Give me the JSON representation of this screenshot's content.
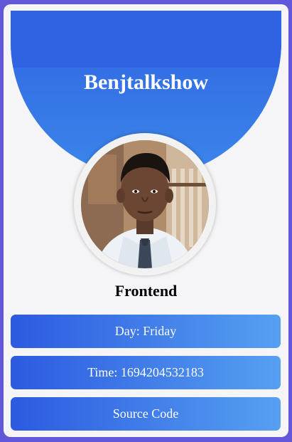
{
  "profile": {
    "name": "Benjtalkshow",
    "role": "Frontend"
  },
  "info": {
    "day_label": "Day: Friday",
    "time_label": "Time: 1694204532183"
  },
  "actions": {
    "source_code_label": "Source Code"
  },
  "colors": {
    "page_background": "#6257d9",
    "card_background": "#f5f4f6",
    "header_gradient_start": "#2f63e2",
    "header_gradient_end": "#3c86ea",
    "button_gradient_start": "#2c5ae0",
    "button_gradient_end": "#56a0f2"
  }
}
